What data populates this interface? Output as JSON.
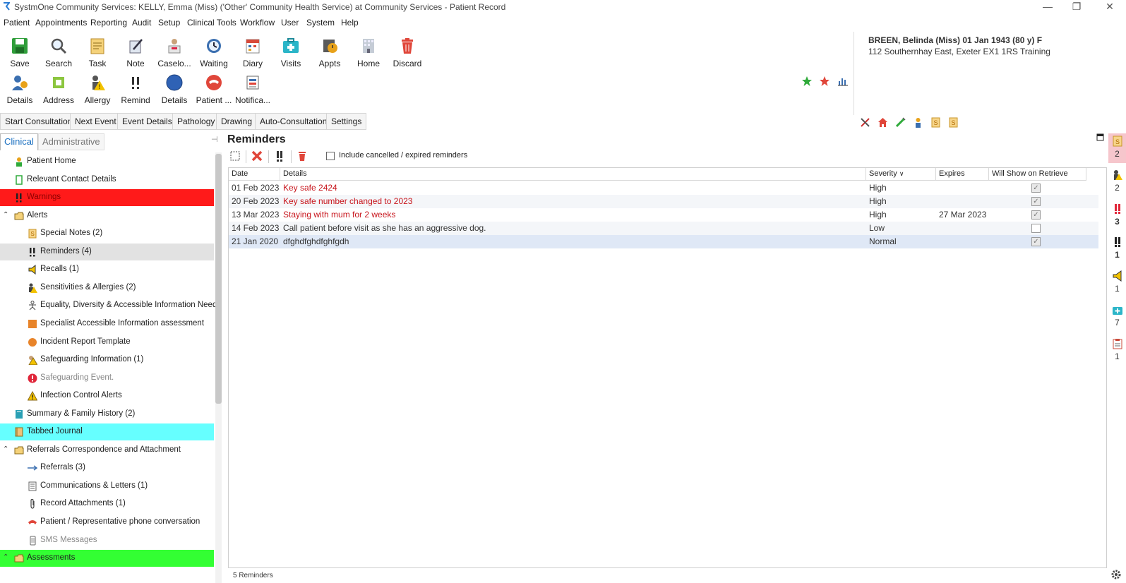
{
  "window": {
    "title": "SystmOne Community Services: KELLY, Emma (Miss) ('Other' Community Health Service) at Community Services - Patient Record"
  },
  "menu": [
    "Patient",
    "Appointments",
    "Reporting",
    "Audit",
    "Setup",
    "Clinical Tools",
    "Workflow",
    "User",
    "System",
    "Help"
  ],
  "toolbar_row1": [
    {
      "label": "Save",
      "icon": "save-icon"
    },
    {
      "label": "Search",
      "icon": "search-icon"
    },
    {
      "label": "Task",
      "icon": "task-icon"
    },
    {
      "label": "Note",
      "icon": "note-icon"
    },
    {
      "label": "Caselo...",
      "icon": "caseload-icon"
    },
    {
      "label": "Waiting",
      "icon": "waiting-icon"
    },
    {
      "label": "Diary",
      "icon": "diary-icon"
    },
    {
      "label": "Visits",
      "icon": "visits-icon"
    },
    {
      "label": "Appts",
      "icon": "appointments-icon"
    },
    {
      "label": "Home",
      "icon": "home-icon"
    },
    {
      "label": "Discard",
      "icon": "discard-icon"
    }
  ],
  "toolbar_row2": [
    {
      "label": "Details",
      "icon": "details-icon"
    },
    {
      "label": "Address",
      "icon": "address-icon"
    },
    {
      "label": "Allergy",
      "icon": "allergy-icon"
    },
    {
      "label": "Remind",
      "icon": "remind-icon"
    },
    {
      "label": "Details",
      "icon": "details-circle-icon"
    },
    {
      "label": "Patient ...",
      "icon": "patient-phone-icon"
    },
    {
      "label": "Notifica...",
      "icon": "notification-icon"
    }
  ],
  "patient": {
    "name_line": "BREEN, Belinda (Miss) 01 Jan 1943 (80 y) F",
    "address_line": "112 Southernhay East, Exeter EX1 1RS  Training"
  },
  "consult_bar": [
    "Start Consultation",
    "Next Event",
    "Event Details",
    "Pathology",
    "Drawing",
    "Auto-Consultation",
    "Settings"
  ],
  "left_tabs": {
    "clinical": "Clinical",
    "administrative": "Administrative"
  },
  "tree": [
    {
      "label": "Patient Home",
      "icon": "person-icon",
      "indent": 0
    },
    {
      "label": "Relevant Contact Details",
      "icon": "phone-book-icon",
      "indent": 0
    },
    {
      "label": "Warnings",
      "icon": "double-exclamation-icon",
      "indent": 0,
      "bg": "#ff1a1a"
    },
    {
      "label": "Alerts",
      "icon": "folder-icon",
      "indent": 0,
      "expander": true
    },
    {
      "label": "Special Notes (2)",
      "icon": "special-notes-icon",
      "indent": 1
    },
    {
      "label": "Reminders (4)",
      "icon": "double-exclamation-icon",
      "indent": 1,
      "selected": true
    },
    {
      "label": "Recalls (1)",
      "icon": "megaphone-icon",
      "indent": 1
    },
    {
      "label": "Sensitivities & Allergies (2)",
      "icon": "allergy-warning-icon",
      "indent": 1
    },
    {
      "label": "Equality, Diversity & Accessible Information Need.",
      "icon": "stick-figure-icon",
      "indent": 1
    },
    {
      "label": "Specialist Accessible Information assessment",
      "icon": "orange-square-icon",
      "indent": 1
    },
    {
      "label": "Incident Report Template",
      "icon": "orange-circle-icon",
      "indent": 1
    },
    {
      "label": "Safeguarding Information (1)",
      "icon": "safeguarding-warning-icon",
      "indent": 1
    },
    {
      "label": "Safeguarding Event.",
      "icon": "red-exclamation-circle-icon",
      "indent": 1,
      "muted": true
    },
    {
      "label": "Infection Control Alerts",
      "icon": "warning-triangle-icon",
      "indent": 1
    },
    {
      "label": "Summary & Family History (2)",
      "icon": "summary-book-icon",
      "indent": 0
    },
    {
      "label": "Tabbed Journal",
      "icon": "journal-icon",
      "indent": 0,
      "bg": "#66ffff"
    },
    {
      "label": "Referrals Correspondence and Attachment",
      "icon": "folder-icon",
      "indent": 0,
      "expander": true
    },
    {
      "label": "Referrals (3)",
      "icon": "arrow-right-icon",
      "indent": 1
    },
    {
      "label": "Communications & Letters (1)",
      "icon": "document-icon",
      "indent": 1
    },
    {
      "label": "Record Attachments (1)",
      "icon": "paperclip-icon",
      "indent": 1
    },
    {
      "label": "Patient / Representative phone conversation",
      "icon": "phone-icon",
      "indent": 1
    },
    {
      "label": "SMS Messages",
      "icon": "mobile-phone-icon",
      "indent": 1,
      "muted": true
    },
    {
      "label": "Assessments",
      "icon": "folder-icon",
      "indent": 0,
      "expander": true,
      "bg": "#33ff33"
    }
  ],
  "reminders": {
    "title": "Reminders",
    "include_cancelled_label": "Include cancelled / expired reminders",
    "columns": {
      "date": "Date",
      "details": "Details",
      "severity": "Severity",
      "expires": "Expires",
      "will_show": "Will Show on Retrieve"
    },
    "rows": [
      {
        "date": "01 Feb 2023",
        "details": "Key safe 2424",
        "severity": "High",
        "expires": "",
        "will_show": true,
        "red": true
      },
      {
        "date": "20 Feb 2023",
        "details": "Key safe number changed to 2023",
        "severity": "High",
        "expires": "",
        "will_show": true,
        "red": true
      },
      {
        "date": "13 Mar 2023",
        "details": "Staying with mum for 2 weeks",
        "severity": "High",
        "expires": "27 Mar 2023",
        "will_show": true,
        "red": true
      },
      {
        "date": "14 Feb 2023",
        "details": "Call patient before visit as she has an aggressive dog.",
        "severity": "Low",
        "expires": "",
        "will_show": false,
        "red": false
      },
      {
        "date": "21 Jan 2020",
        "details": "dfghdfghdfghfgdh",
        "severity": "Normal",
        "expires": "",
        "will_show": true,
        "red": false,
        "selected": true
      }
    ],
    "status": "5 Reminders"
  },
  "right_strip": [
    {
      "icon": "special-notes-icon",
      "count": "2"
    },
    {
      "icon": "allergy-warning-icon",
      "count": "2"
    },
    {
      "icon": "red-double-exclamation-icon",
      "count": "3"
    },
    {
      "icon": "double-exclamation-icon",
      "count": "1"
    },
    {
      "icon": "megaphone-icon",
      "count": "1"
    },
    {
      "icon": "medical-kit-icon",
      "count": "7"
    },
    {
      "icon": "clipboard-icon",
      "count": "1"
    }
  ]
}
